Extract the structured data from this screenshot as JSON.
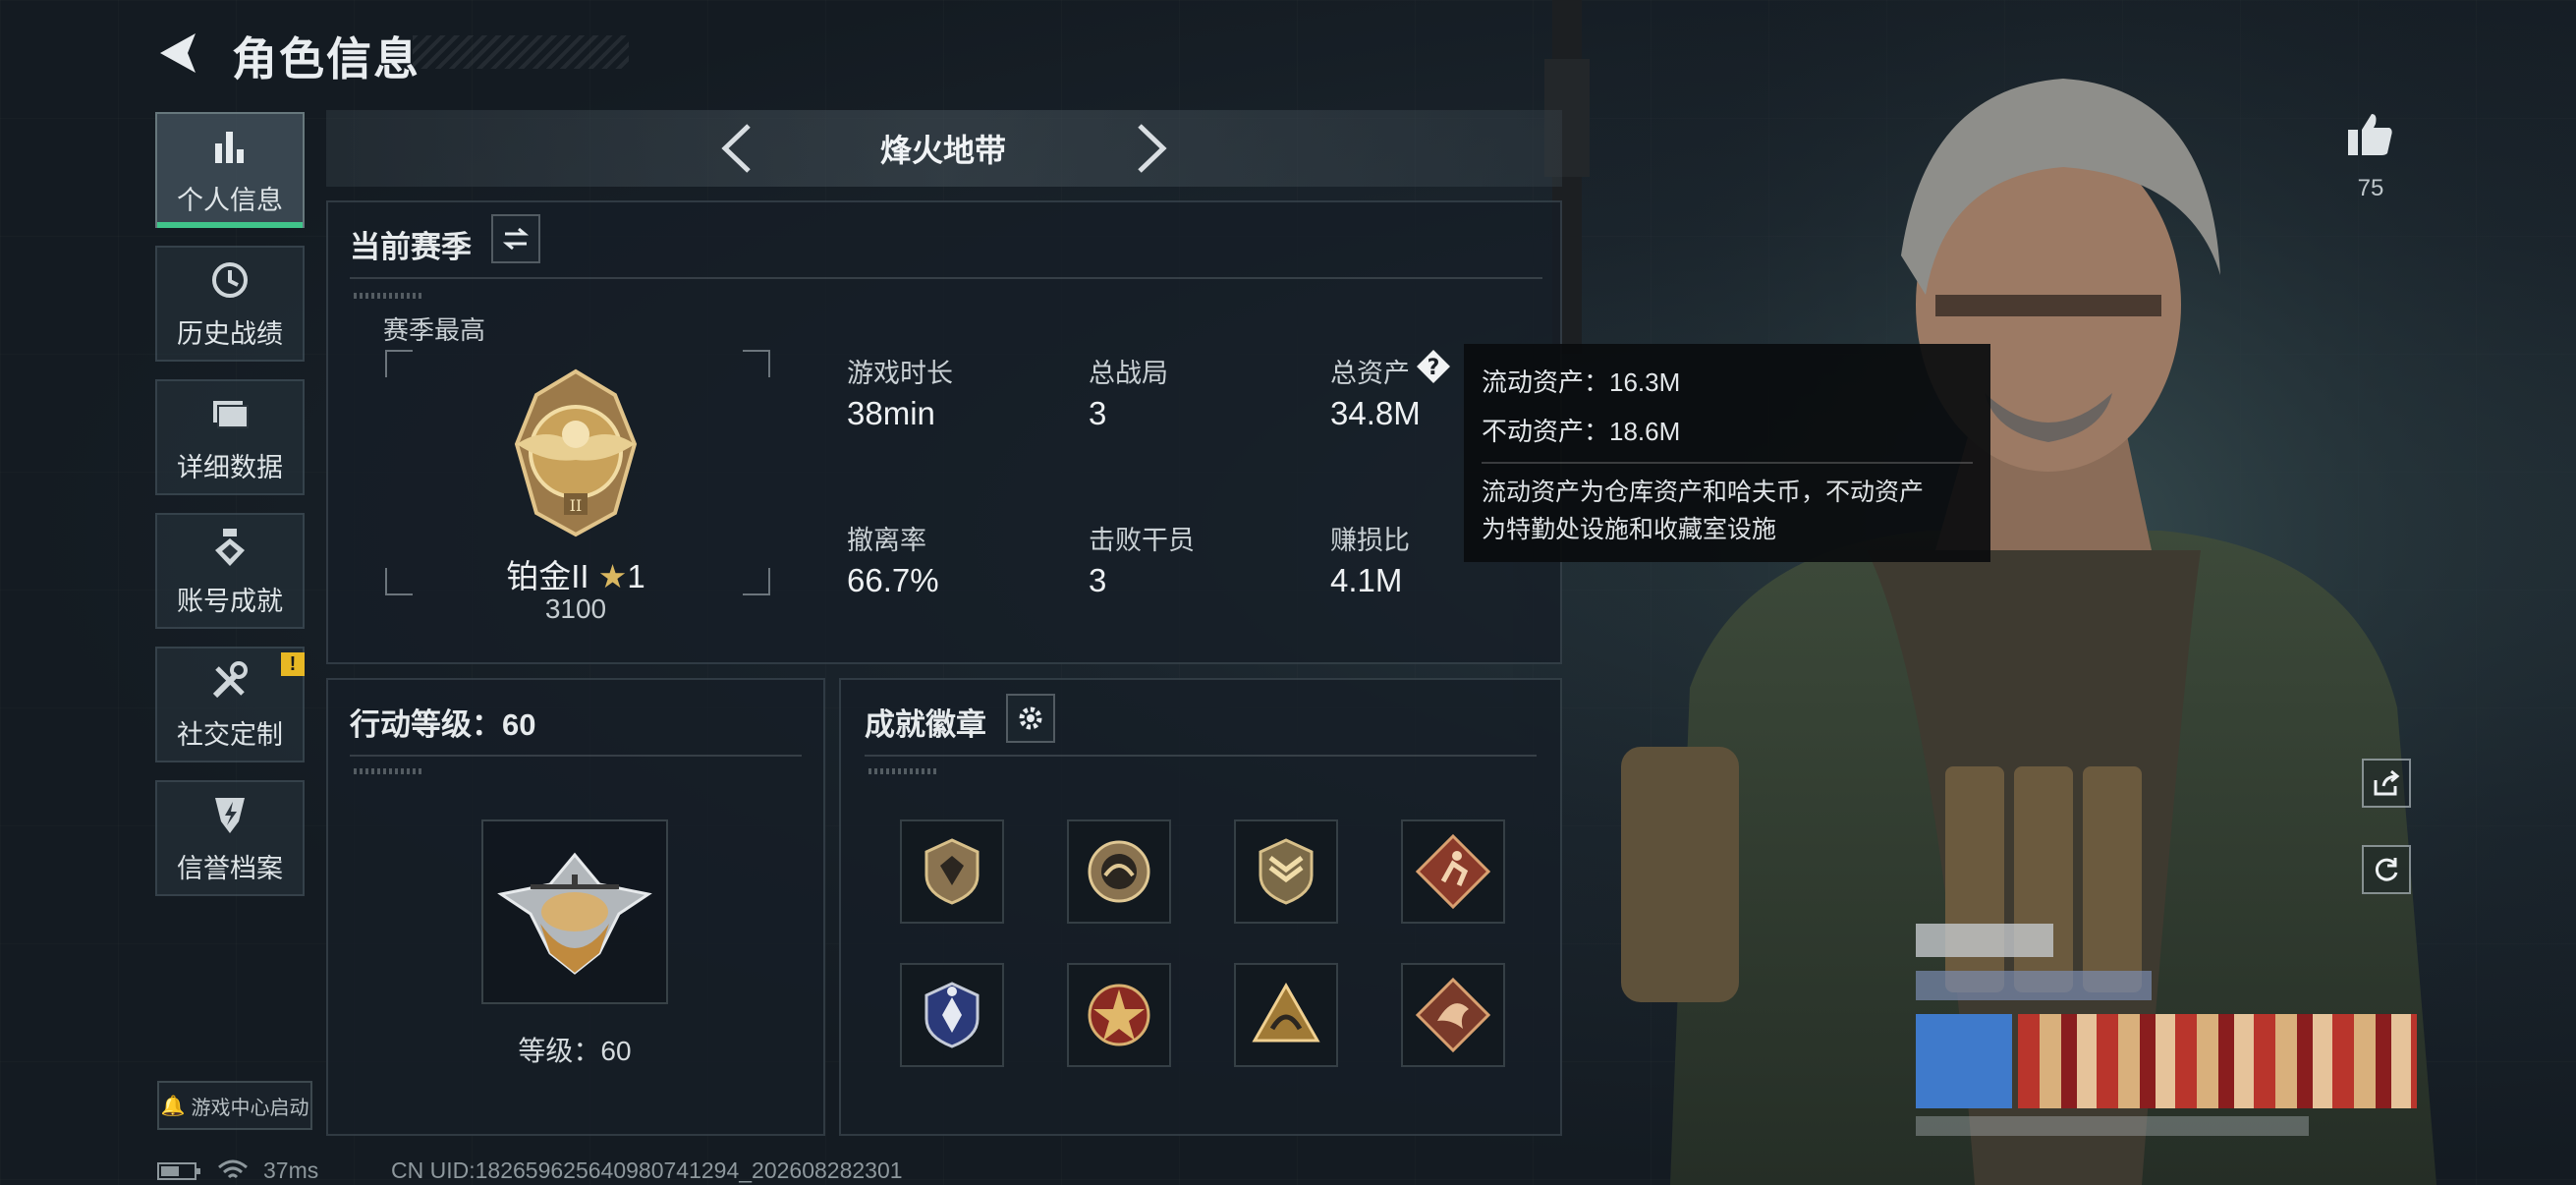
{
  "header": {
    "title": "角色信息"
  },
  "sidebar": {
    "items": [
      {
        "label": "个人信息",
        "icon": "bar-chart-icon",
        "active": true
      },
      {
        "label": "历史战绩",
        "icon": "history-icon"
      },
      {
        "label": "详细数据",
        "icon": "folder-icon"
      },
      {
        "label": "账号成就",
        "icon": "achievement-icon"
      },
      {
        "label": "社交定制",
        "icon": "tools-icon",
        "badge": "!"
      },
      {
        "label": "信誉档案",
        "icon": "credit-icon"
      }
    ],
    "game_center_label": "游戏中心启动"
  },
  "mode": {
    "title": "烽火地带"
  },
  "season": {
    "title": "当前赛季",
    "best_label": "赛季最高",
    "rank_name": "铂金II",
    "rank_stars": "1",
    "rank_points": "3100",
    "stats": [
      {
        "label": "游戏时长",
        "value": "38min"
      },
      {
        "label": "总战局",
        "value": "3"
      },
      {
        "label": "总资产",
        "value": "34.8M",
        "help": true
      },
      {
        "label": "撤离率",
        "value": "66.7%"
      },
      {
        "label": "击败干员",
        "value": "3"
      },
      {
        "label": "赚损比",
        "value": "4.1M"
      }
    ]
  },
  "tooltip": {
    "line1": "流动资产：16.3M",
    "line2": "不动资产：18.6M",
    "note_line1": "流动资产为仓库资产和哈夫币，不动资产",
    "note_line2": "为特勤处设施和收藏室设施"
  },
  "level": {
    "title": "行动等级：60",
    "caption": "等级：60"
  },
  "badges": {
    "title": "成就徽章",
    "count": 8
  },
  "social": {
    "likes": "75"
  },
  "footer": {
    "ping": "37ms",
    "uid": "CN UID:1826596256409807412​94_202608282301"
  },
  "colors": {
    "accent": "#40c48a",
    "warning": "#e8b824",
    "gold": "#c9a25a"
  }
}
